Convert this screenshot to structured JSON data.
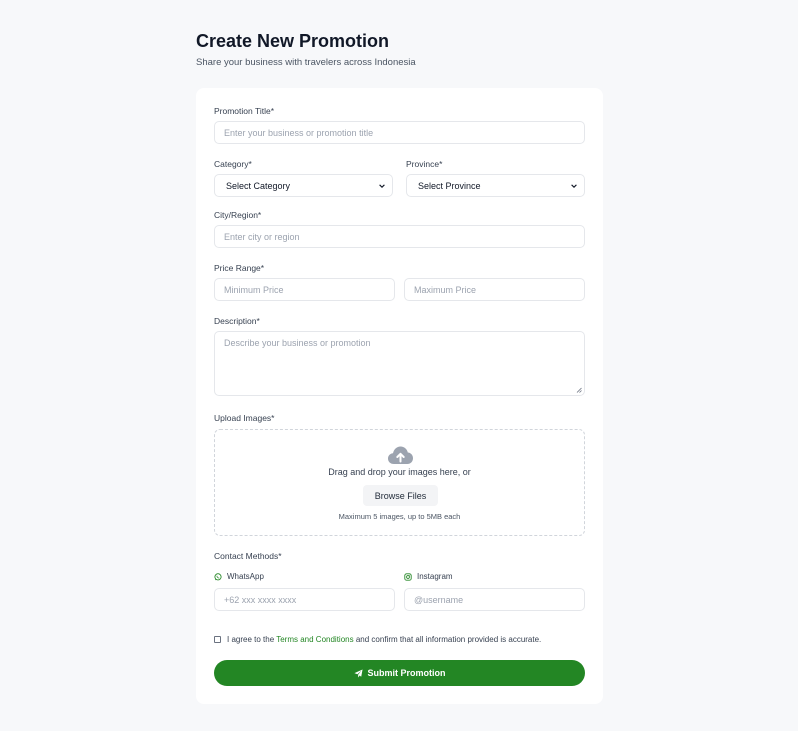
{
  "header": {
    "title": "Create New Promotion",
    "subtitle": "Share your business with travelers across Indonesia"
  },
  "form": {
    "title": {
      "label": "Promotion Title*",
      "placeholder": "Enter your business or promotion title"
    },
    "category": {
      "label": "Category*",
      "value": "Select Category"
    },
    "province": {
      "label": "Province*",
      "value": "Select Province"
    },
    "city": {
      "label": "City/Region*",
      "placeholder": "Enter city or region"
    },
    "price": {
      "label": "Price Range*",
      "min_placeholder": "Minimum Price",
      "max_placeholder": "Maximum Price"
    },
    "description": {
      "label": "Description*",
      "placeholder": "Describe your business or promotion"
    },
    "upload": {
      "label": "Upload Images*",
      "drop_text": "Drag and drop your images here, or",
      "browse_label": "Browse Files",
      "hint": "Maximum 5 images, up to 5MB each",
      "icon": "cloud-upload-icon"
    },
    "contact": {
      "label": "Contact Methods*",
      "whatsapp": {
        "label": "WhatsApp",
        "placeholder": "+62 xxx xxxx xxxx",
        "icon": "whatsapp-icon"
      },
      "instagram": {
        "label": "Instagram",
        "placeholder": "@username",
        "icon": "instagram-icon"
      }
    },
    "agreement": {
      "prefix": "I agree to the",
      "link": "Terms and Conditions",
      "suffix": "and confirm that all information provided is accurate.",
      "checked": false
    },
    "submit": {
      "label": "Submit Promotion",
      "icon": "send-icon"
    }
  },
  "colors": {
    "accent": "#238624",
    "background": "#f7f8fa",
    "card": "#ffffff",
    "border": "#e5e7eb",
    "placeholder": "#9ca3af"
  }
}
